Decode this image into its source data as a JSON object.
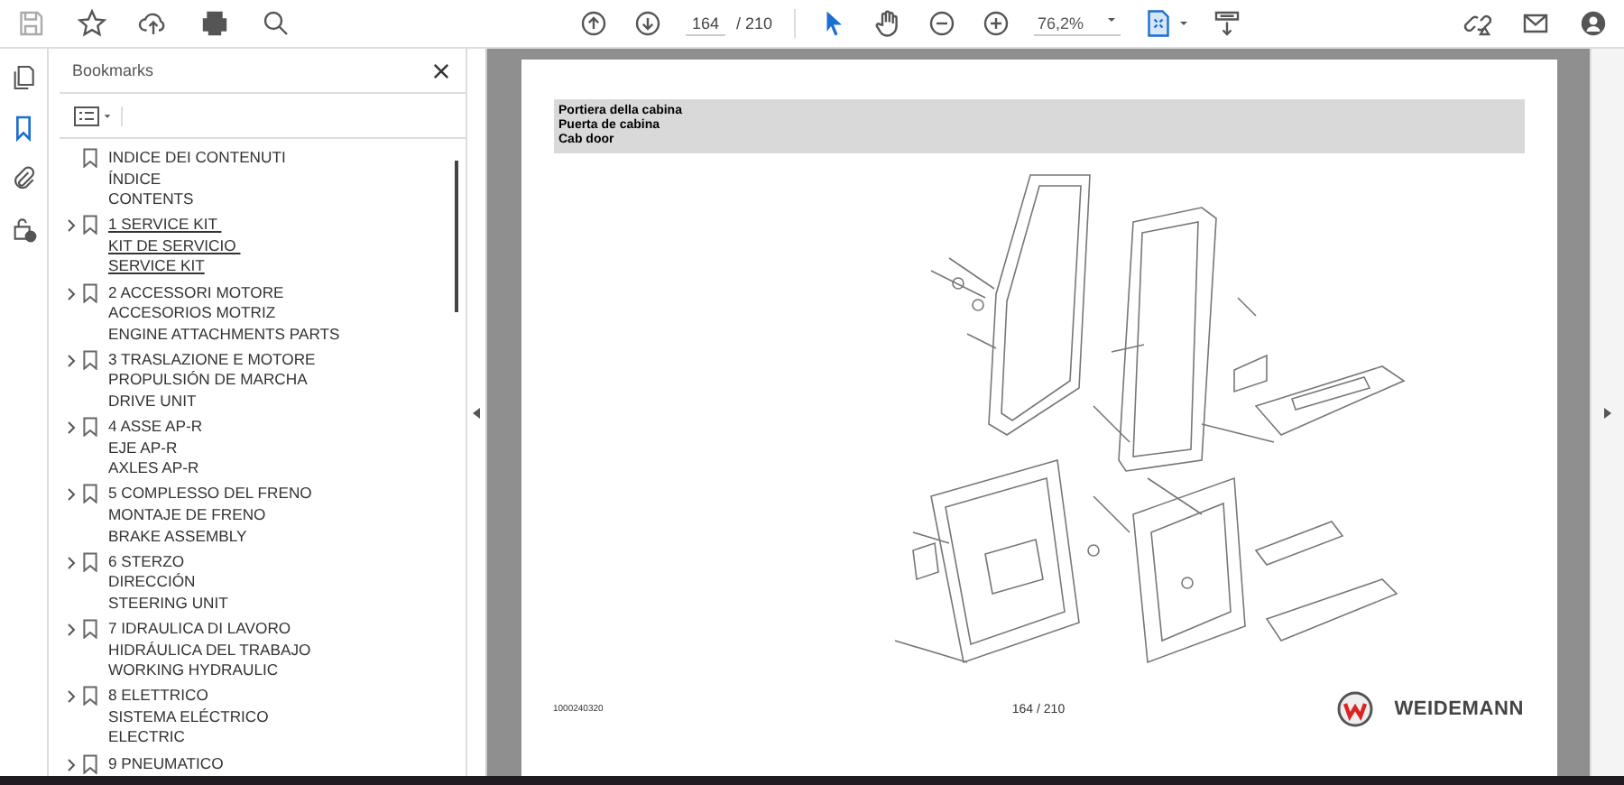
{
  "toolbar": {
    "page_current": "164",
    "page_total": "/ 210",
    "zoom": "76,2%"
  },
  "sidebar": {
    "title": "Bookmarks",
    "bookmarks": [
      {
        "lines": [
          "INDICE DEI CONTENUTI",
          "ÍNDICE",
          "CONTENTS"
        ],
        "expandable": false,
        "selected": false
      },
      {
        "lines": [
          "1 SERVICE KIT ",
          "KIT DE SERVICIO ",
          "SERVICE KIT"
        ],
        "expandable": true,
        "selected": true
      },
      {
        "lines": [
          "2 ACCESSORI MOTORE",
          "ACCESORIOS MOTRIZ",
          "ENGINE ATTACHMENTS PARTS"
        ],
        "expandable": true,
        "selected": false
      },
      {
        "lines": [
          "3 TRASLAZIONE E MOTORE",
          "PROPULSIÓN DE MARCHA",
          "DRIVE UNIT"
        ],
        "expandable": true,
        "selected": false
      },
      {
        "lines": [
          "4 ASSE AP-R",
          "EJE AP-R",
          "AXLES AP-R"
        ],
        "expandable": true,
        "selected": false
      },
      {
        "lines": [
          "5 COMPLESSO DEL FRENO",
          "MONTAJE DE FRENO",
          "BRAKE ASSEMBLY"
        ],
        "expandable": true,
        "selected": false
      },
      {
        "lines": [
          "6 STERZO",
          "DIRECCIÓN",
          "STEERING UNIT"
        ],
        "expandable": true,
        "selected": false
      },
      {
        "lines": [
          "7 IDRAULICA DI LAVORO",
          "HIDRÁULICA DEL TRABAJO",
          "WORKING HYDRAULIC"
        ],
        "expandable": true,
        "selected": false
      },
      {
        "lines": [
          "8 ELETTRICO",
          "SISTEMA ELÉCTRICO",
          "ELECTRIC"
        ],
        "expandable": true,
        "selected": false
      },
      {
        "lines": [
          "9 PNEUMATICO"
        ],
        "expandable": true,
        "selected": false
      }
    ]
  },
  "document": {
    "header_lines": [
      "Portiera della cabina",
      "Puerta de cabina",
      "Cab door"
    ],
    "doc_number": "1000240320",
    "page_label": "164 / 210",
    "brand": "WEIDEMANN"
  }
}
